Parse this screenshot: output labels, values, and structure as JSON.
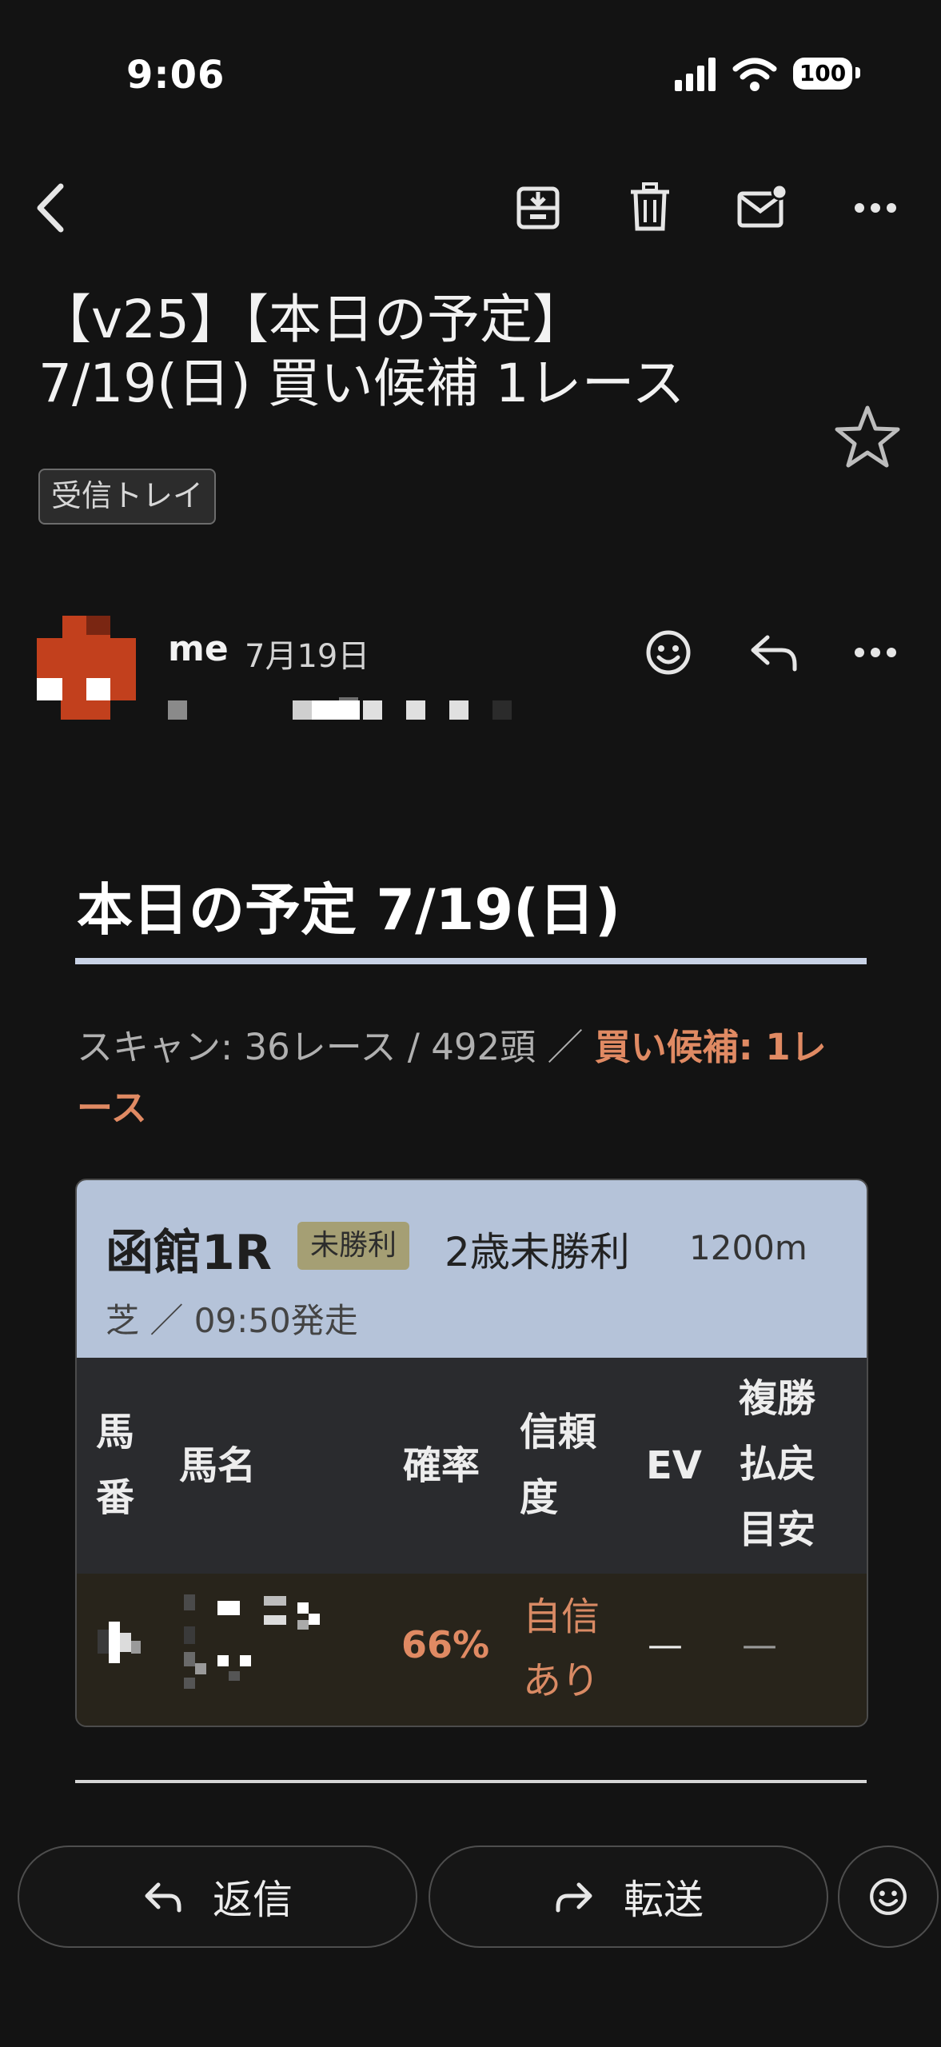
{
  "status_bar": {
    "time": "9:06",
    "battery": "100"
  },
  "toolbar": {
    "back": "back-icon",
    "archive": "archive-icon",
    "delete": "trash-icon",
    "mark_unread": "mail-unread-icon",
    "more": "more-icon"
  },
  "email": {
    "subject_line1": "【v25】【本日の予定】",
    "subject_line2": "7/19(日) 買い候補 1レース",
    "label": "受信トレイ",
    "sender": "me",
    "date": "7月19日"
  },
  "body": {
    "heading": "本日の予定 7/19(日)",
    "scan_prefix": "スキャン: 36レース / 492頭 ／ ",
    "scan_highlight": "買い候補: 1レース"
  },
  "race": {
    "venue": "函館1R",
    "class_badge": "未勝利",
    "race_name": "2歳未勝利",
    "distance": "1200m",
    "surface_time": "芝 ／ 09:50発走",
    "columns": {
      "number": "馬番",
      "name": "馬名",
      "probability": "確率",
      "confidence": "信頼度",
      "ev": "EV",
      "payout": "複勝払戻目安"
    },
    "rows": [
      {
        "probability": "66%",
        "confidence": "自信あり",
        "ev": "—",
        "payout": "—"
      }
    ]
  },
  "actions": {
    "reply": "返信",
    "forward": "転送"
  },
  "colors": {
    "accent": "#e08a63",
    "card_header": "#b5c3d9",
    "avatar": "#c2401d"
  }
}
